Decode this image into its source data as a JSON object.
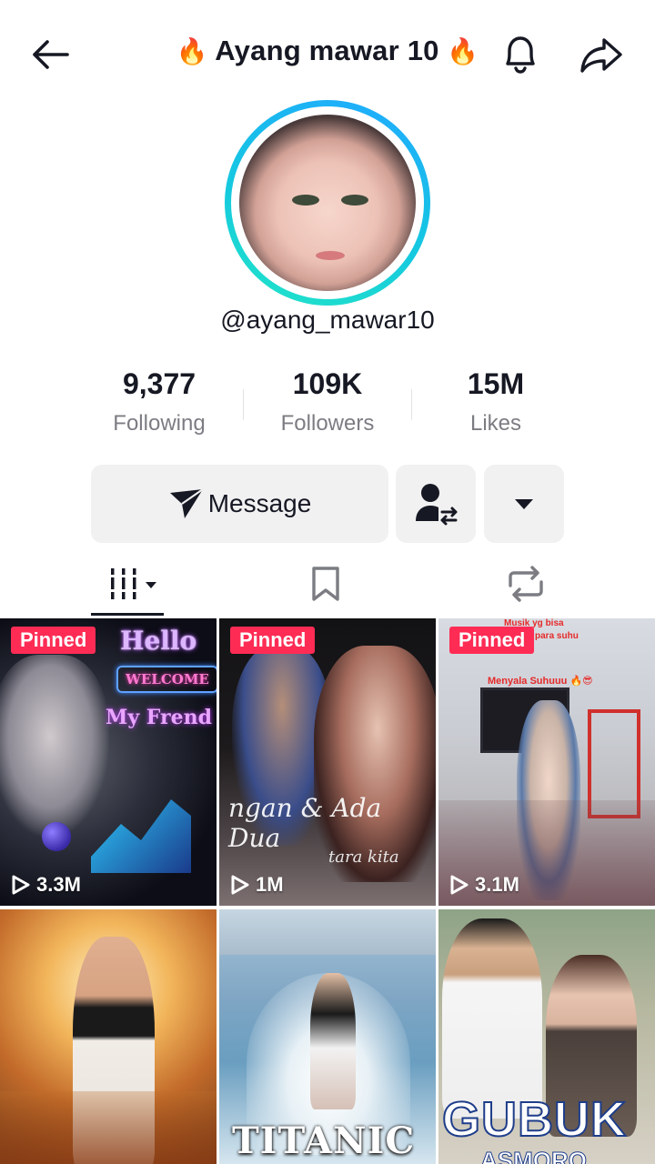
{
  "header": {
    "title_prefix": "🔥",
    "title": "Ayang mawar 10",
    "title_suffix": "🔥"
  },
  "profile": {
    "username": "@ayang_mawar10",
    "stats": [
      {
        "value": "9,377",
        "label": "Following"
      },
      {
        "value": "109K",
        "label": "Followers"
      },
      {
        "value": "15M",
        "label": "Likes"
      }
    ]
  },
  "actions": {
    "message_label": "Message"
  },
  "tabs": [
    {
      "name": "videos",
      "icon": "grid-bars-icon",
      "active": true
    },
    {
      "name": "favorites",
      "icon": "bookmark-icon",
      "active": false
    },
    {
      "name": "reposts",
      "icon": "repost-icon",
      "active": false
    }
  ],
  "videos": [
    {
      "pinned_label": "Pinned",
      "views": "3.3M",
      "overlay": [
        "Hello",
        "WELCOME",
        "My Frend"
      ]
    },
    {
      "pinned_label": "Pinned",
      "views": "1M",
      "overlay": [
        "ngan & Ada Dua",
        "tara kita"
      ]
    },
    {
      "pinned_label": "Pinned",
      "views": "3.1M",
      "overlay": [
        "Musik yg bisa",
        "kan para suhu",
        "Menyala Suhuuu 🔥😎"
      ]
    },
    {
      "views": "",
      "overlay": []
    },
    {
      "views": "",
      "overlay": [
        "TITANIC"
      ]
    },
    {
      "views": "",
      "overlay": [
        "GUBUK",
        "ASMORO"
      ]
    }
  ],
  "colors": {
    "accent_red": "#fe2c55",
    "text_primary": "#161823",
    "text_secondary": "#7c7d83",
    "button_bg": "#f1f1f2",
    "ring_gradient": [
      "#21a9ff",
      "#21e4c7"
    ]
  }
}
